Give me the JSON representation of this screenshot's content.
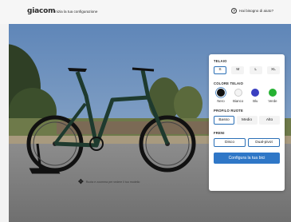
{
  "header": {
    "brand": "giacom",
    "subtitle": "Inizia la tua configurazione",
    "help_label": "Hai bisogno di aiuto?",
    "help_icon": "question-circle-icon"
  },
  "config": {
    "frame": {
      "title": "TELAIO",
      "sizes": [
        "S",
        "M",
        "L",
        "XL"
      ],
      "selected": "S"
    },
    "frame_color": {
      "title": "COLORE TELAIO",
      "options": [
        {
          "label": "Nero",
          "color": "#111111"
        },
        {
          "label": "Bianco",
          "color": "#f4f4f4"
        },
        {
          "label": "Blu",
          "color": "#3a3fc0"
        },
        {
          "label": "Verde",
          "color": "#26b233"
        }
      ],
      "selected": "Nero"
    },
    "wheel_profile": {
      "title": "PROFILO RUOTE",
      "options": [
        "Basso",
        "Medio",
        "Alto"
      ],
      "selected": "Basso"
    },
    "brakes": {
      "title": "FRENI",
      "options": [
        "Disco",
        "Dual-pivot"
      ]
    },
    "cta_label": "Configura la tua bici"
  },
  "hint": {
    "text": "Ruota e zoomma per vedere il tuo modello",
    "icon": "move-cross-icon"
  },
  "colors": {
    "accent": "#2f77c7",
    "selected_border": "#2a6fb6"
  }
}
